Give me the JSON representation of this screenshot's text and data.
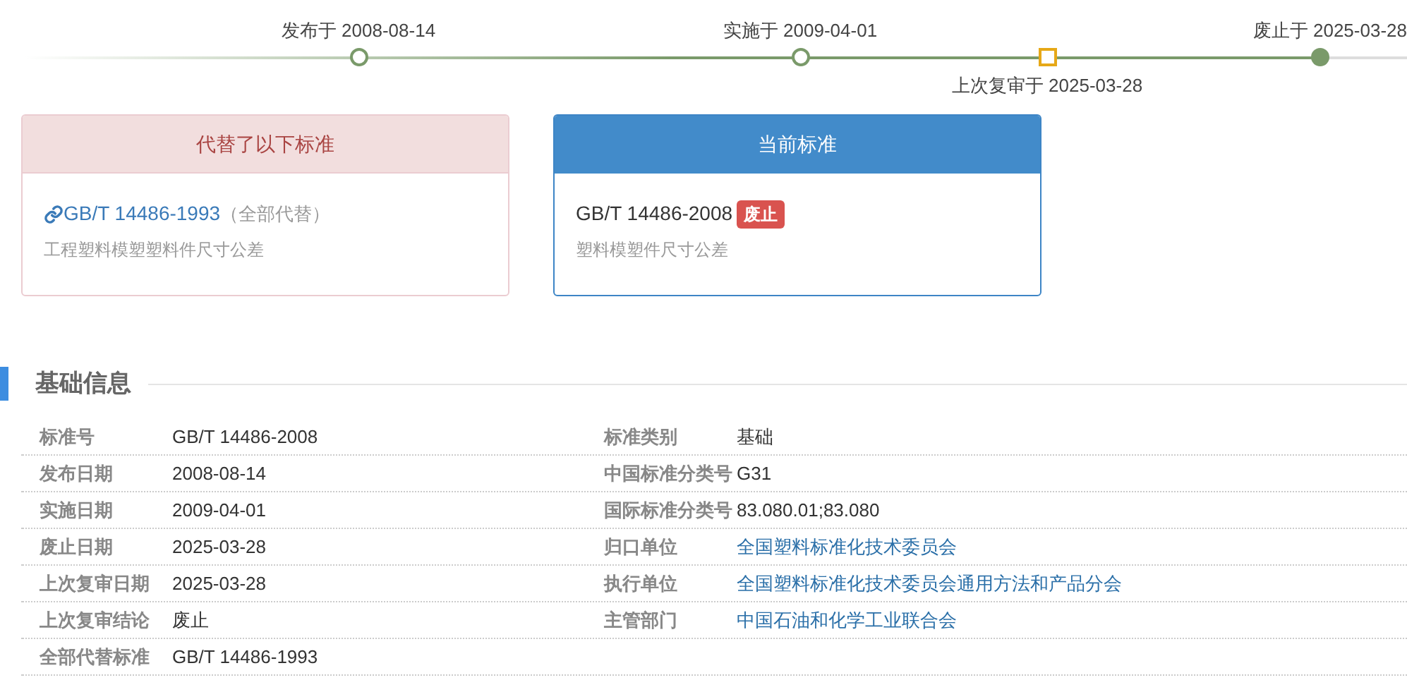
{
  "timeline": {
    "events": [
      {
        "label": "发布于 2008-08-14",
        "kind": "milestone"
      },
      {
        "label": "实施于 2009-04-01",
        "kind": "milestone"
      },
      {
        "label": "上次复审于 2025-03-28",
        "kind": "review"
      },
      {
        "label": "废止于 2025-03-28",
        "kind": "current"
      }
    ]
  },
  "replaced_card": {
    "title": "代替了以下标准",
    "code": "GB/T 14486-1993",
    "note": "（全部代替）",
    "name": "工程塑料模塑塑料件尺寸公差"
  },
  "current_card": {
    "title": "当前标准",
    "code": "GB/T 14486-2008",
    "badge": "废止",
    "name": "塑料模塑件尺寸公差"
  },
  "section": {
    "title": "基础信息"
  },
  "info_rows": [
    [
      {
        "label": "标准号",
        "value": "GB/T 14486-2008",
        "kind": "text"
      },
      {
        "label": "标准类别",
        "value": "基础",
        "kind": "text"
      }
    ],
    [
      {
        "label": "发布日期",
        "value": "2008-08-14",
        "kind": "text"
      },
      {
        "label": "中国标准分类号",
        "value": "G31",
        "kind": "text"
      }
    ],
    [
      {
        "label": "实施日期",
        "value": "2009-04-01",
        "kind": "text"
      },
      {
        "label": "国际标准分类号",
        "value": "83.080.01;83.080",
        "kind": "text"
      }
    ],
    [
      {
        "label": "废止日期",
        "value": "2025-03-28",
        "kind": "text"
      },
      {
        "label": "归口单位",
        "value": "全国塑料标准化技术委员会",
        "kind": "link"
      }
    ],
    [
      {
        "label": "上次复审日期",
        "value": "2025-03-28",
        "kind": "text"
      },
      {
        "label": "执行单位",
        "value": "全国塑料标准化技术委员会通用方法和产品分会",
        "kind": "link"
      }
    ],
    [
      {
        "label": "上次复审结论",
        "value": "废止",
        "kind": "text"
      },
      {
        "label": "主管部门",
        "value": "中国石油和化学工业联合会",
        "kind": "link"
      }
    ],
    [
      {
        "label": "全部代替标准",
        "value": "GB/T 14486-1993",
        "kind": "text"
      }
    ]
  ]
}
